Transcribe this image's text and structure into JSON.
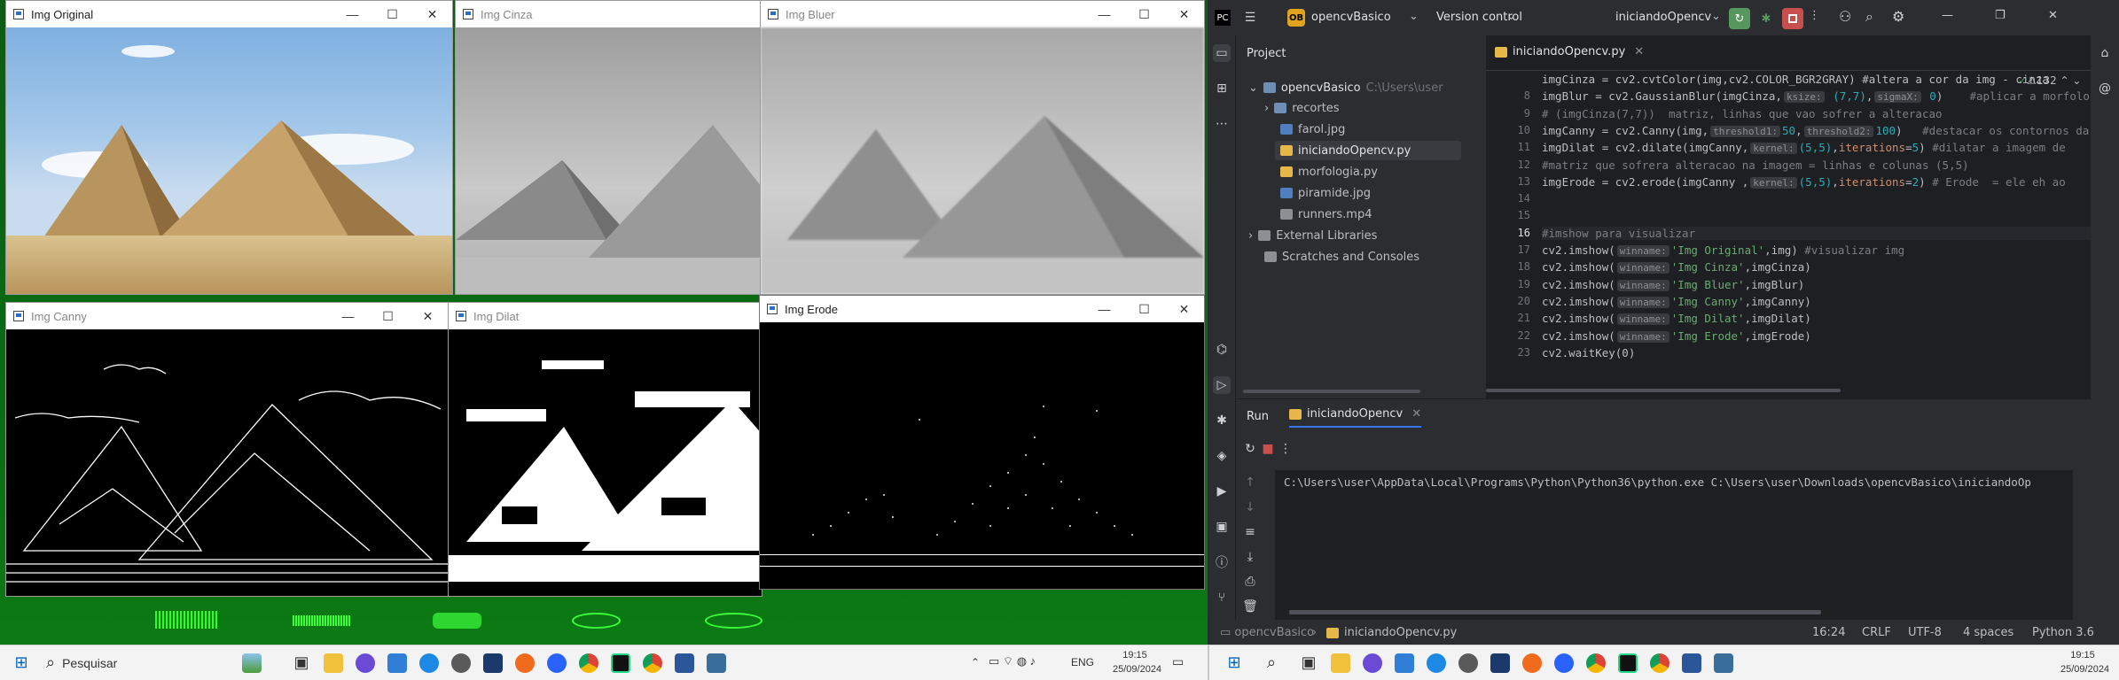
{
  "cv_windows": {
    "original": {
      "title": "Img Original"
    },
    "cinza": {
      "title": "Img Cinza"
    },
    "bluer": {
      "title": "Img Bluer"
    },
    "canny": {
      "title": "Img Canny"
    },
    "dilat": {
      "title": "Img Dilat"
    },
    "erode": {
      "title": "Img Erode"
    },
    "minimize": "—",
    "maximize": "☐",
    "close": "✕"
  },
  "ide": {
    "project_name": "opencvBasico",
    "vcs": "Version control",
    "run_config": "iniciandoOpencv",
    "tab_file": "iniciandoOpencv.py",
    "project_label": "Project",
    "tree": {
      "root": "opencvBasico",
      "root_path": "C:\\Users\\user",
      "items": [
        "recortes",
        "farol.jpg",
        "iniciandoOpencv.py",
        "morfologia.py",
        "piramide.jpg",
        "runners.mp4"
      ],
      "external": "External Libraries",
      "scratches": "Scratches and Consoles"
    },
    "warnings_count": "132",
    "code_lines": [
      {
        "n": "",
        "t": "imgCinza = cv2.cvtColor(img,cv2.COLOR_BGR2GRAY) #altera a cor da img - cinza"
      },
      {
        "n": "8",
        "t": "imgBlur = cv2.GaussianBlur(imgCinza,"
      },
      {
        "n": "9",
        "t": "# (imgCinza(7,7))  matriz, linhas que vao sofrer a alteracao"
      },
      {
        "n": "10",
        "t": "imgCanny = cv2.Canny(img,"
      },
      {
        "n": "11",
        "t": "imgDilat = cv2.dilate(imgCanny,"
      },
      {
        "n": "12",
        "t": "#matriz que sofrera alteracao na imagem = linhas e colunas (5,5)"
      },
      {
        "n": "13",
        "t": "imgErode = cv2.erode(imgCanny ,"
      },
      {
        "n": "14",
        "t": ""
      },
      {
        "n": "15",
        "t": ""
      },
      {
        "n": "16",
        "t": "#imshow para visualizar"
      },
      {
        "n": "17",
        "t": "cv2.imshow("
      },
      {
        "n": "18",
        "t": "cv2.imshow("
      },
      {
        "n": "19",
        "t": "cv2.imshow("
      },
      {
        "n": "20",
        "t": "cv2.imshow("
      },
      {
        "n": "21",
        "t": "cv2.imshow("
      },
      {
        "n": "22",
        "t": "cv2.imshow("
      },
      {
        "n": "23",
        "t": "cv2.waitKey(0)"
      }
    ],
    "run_tab": "Run",
    "run_config_tab": "iniciandoOpencv",
    "console_line": "C:\\Users\\user\\AppData\\Local\\Programs\\Python\\Python36\\python.exe C:\\Users\\user\\Downloads\\opencvBasico\\iniciandoOp",
    "status": {
      "breadcrumb_project": "opencvBasico",
      "breadcrumb_file": "iniciandoOpencv.py",
      "position": "16:24",
      "line_sep": "CRLF",
      "encoding": "UTF-8",
      "indent": "4 spaces",
      "interpreter": "Python 3.6"
    }
  },
  "taskbar_left": {
    "search_placeholder": "Pesquisar",
    "lang": "ENG",
    "time": "19:15",
    "date": "25/09/2024"
  },
  "taskbar_right": {
    "time": "19:15",
    "date": "25/09/2024"
  }
}
